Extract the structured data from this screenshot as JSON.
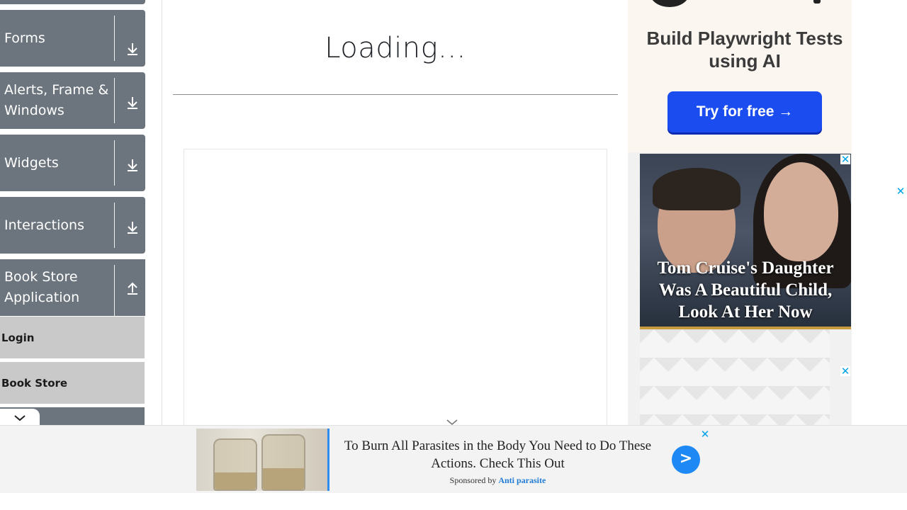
{
  "sidebar": {
    "groups": [
      {
        "label": "Forms",
        "state": "collapsed"
      },
      {
        "label": "Alerts, Frame & Windows",
        "state": "collapsed"
      },
      {
        "label": "Widgets",
        "state": "collapsed"
      },
      {
        "label": "Interactions",
        "state": "collapsed"
      },
      {
        "label": "Book Store Application",
        "state": "expanded"
      }
    ],
    "book_store_items": [
      "Login",
      "Book Store"
    ]
  },
  "main": {
    "loading_text": "Loading..."
  },
  "ads": {
    "right_top": {
      "headline": "Build Playwright Tests using AI",
      "cta": "Try for free →"
    },
    "right_image": {
      "caption": "Tom Cruise's Daughter Was A Beautiful Child, Look At Her Now",
      "close": "✕"
    },
    "right_pattern": {
      "close": "✕"
    },
    "page_edge_close": "✕",
    "bottom_banner": {
      "text": "To Burn All Parasites in the Body You Need to Do These Actions. Check This Out",
      "sponsored_prefix": "Sponsored by",
      "sponsor": "Anti parasite",
      "go": ">",
      "close": "✕"
    }
  },
  "colors": {
    "sidebar_group": "#6c757d",
    "sidebar_item": "#c9c9c9",
    "cta_blue": "#1a4cf0",
    "close_blue": "#00a2e8"
  }
}
